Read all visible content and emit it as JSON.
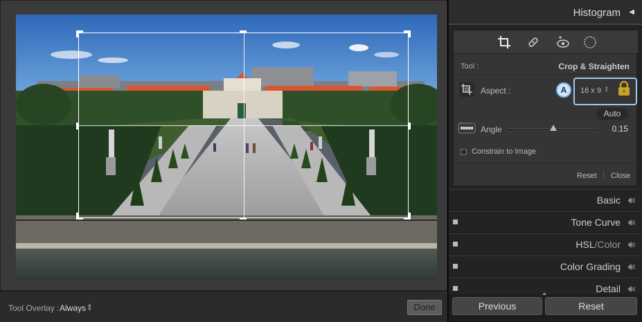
{
  "canvas": {
    "photo_subject": "garden-palace-photo",
    "tool_overlay_label": "Tool Overlay :",
    "tool_overlay_value": "Always",
    "done_label": "Done"
  },
  "histogram": {
    "title": "Histogram"
  },
  "tool_strip": {
    "icons": [
      "crop-icon",
      "healing-icon",
      "red-eye-icon",
      "mask-icon"
    ]
  },
  "crop_tool": {
    "tool_label": "Tool :",
    "tool_name": "Crop & Straighten",
    "aspect_label": "Aspect :",
    "badge": "A",
    "aspect_value": "16 x 9",
    "auto_label": "Auto",
    "angle_label": "Angle",
    "angle_value": "0.15",
    "angle_slider_fraction": 0.52,
    "constrain_label": "Constrain to Image",
    "reset_label": "Reset",
    "close_label": "Close"
  },
  "sections": {
    "basic": "Basic",
    "tone_curve": "Tone Curve",
    "hsl": "HSL",
    "hsl_slash": "/",
    "color": "Color",
    "color_grading": "Color Grading",
    "detail": "Detail"
  },
  "actions": {
    "previous_label": "Previous",
    "reset_label": "Reset"
  },
  "colors": {
    "accent_highlight": "#9bc9f1",
    "lock_gold": "#c9a227",
    "roof_red": "#d9552f",
    "hedge_green": "#2f4f2a"
  }
}
